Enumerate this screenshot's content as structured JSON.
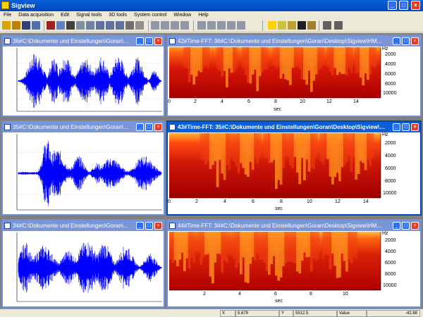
{
  "app": {
    "title": "Sigview",
    "accent": "#0a5fd8",
    "window_controls": [
      "minimize-icon",
      "maximize-icon",
      "close-icon"
    ]
  },
  "menu": [
    "File",
    "Data acquisition",
    "Edit",
    "Signal tools",
    "3D tools",
    "System control",
    "Window",
    "Help"
  ],
  "windows": {
    "w36": {
      "title": "36#C:\\Dokumente und Einstellungen\\Goran\\D..."
    },
    "w35": {
      "title": "35#C:\\Dokumente und Einstellungen\\Goran\\..."
    },
    "w34": {
      "title": "34#C:\\Dokumente und Einstellungen\\Goran\\..."
    },
    "w42": {
      "title": "42#Time-FFT:  36#C:\\Dokumente und Einstellungen\\Goran\\Desktop\\Sigview\\HM...",
      "x_ticks": [
        "0",
        "2",
        "4",
        "6",
        "8",
        "10",
        "12",
        "14"
      ],
      "y_ticks": [
        "Hz",
        "2000",
        "4000",
        "6000",
        "8000",
        "10000"
      ],
      "xunit": "sec"
    },
    "w43": {
      "title": "43#Time-FFT:  35#C:\\Dokumente und Einstellungen\\Goran\\Desktop\\Sigview\\HM...",
      "x_ticks": [
        "0",
        "2",
        "4",
        "6",
        "8",
        "10",
        "12",
        "14"
      ],
      "y_ticks": [
        "Hz",
        "2000",
        "4000",
        "6000",
        "8000",
        "10000"
      ],
      "xunit": "sec"
    },
    "w44": {
      "title": "44#Time-FFT:  34#C:\\Dokumente und Einstellungen\\Goran\\Desktop\\Sigview\\HM...",
      "x_ticks": [
        "2",
        "4",
        "6",
        "8",
        "10"
      ],
      "y_ticks": [
        "Hz",
        "2000",
        "4000",
        "6000",
        "8000",
        "10000"
      ],
      "xunit": "sec"
    }
  },
  "status": {
    "x_label": "X",
    "x_value": "5.679",
    "y_label": "Y",
    "y_value": "5512.5",
    "value_label": "Value",
    "value": "-42.88"
  },
  "colors": {
    "waveform": "#0000ff",
    "spectrogram_low": "#b00000",
    "spectrogram_high": "#ffff40"
  }
}
